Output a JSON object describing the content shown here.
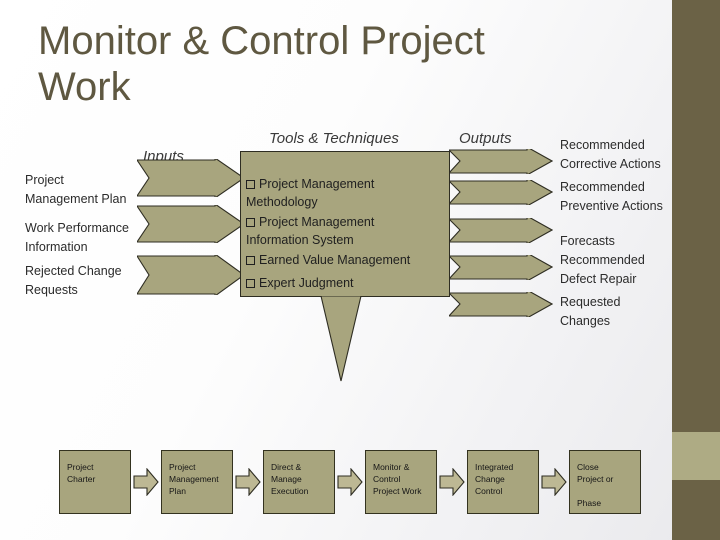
{
  "slide": {
    "title": "Monitor & Control Project\nWork",
    "accent_color": "#6b6246",
    "accent_light_color": "#aeab84",
    "shape_fill_color": "#a8a57e",
    "shape_outline_color": "#2e2d22"
  },
  "columns": {
    "inputs_heading": "Inputs",
    "tools_heading": "Tools & Techniques",
    "outputs_heading": "Outputs"
  },
  "inputs": [
    {
      "label": "Project\nManagement Plan"
    },
    {
      "label": "Work Performance\nInformation"
    },
    {
      "label": "Rejected Change\nRequests"
    }
  ],
  "tools": [
    {
      "bullet": "square-bullet-icon",
      "label": "Project Management\n  Methodology"
    },
    {
      "bullet": "square-bullet-icon",
      "label": "Project Management\n  Information System"
    },
    {
      "bullet": "square-bullet-icon",
      "label": "Earned Value Management"
    },
    {
      "bullet": "square-bullet-icon",
      "label": "Expert Judgment"
    }
  ],
  "outputs": [
    {
      "label": "Recommended\nCorrective Actions"
    },
    {
      "label": "Recommended\nPreventive Actions"
    },
    {
      "label": "Forecasts"
    },
    {
      "label": "Recommended\nDefect Repair"
    },
    {
      "label": "Requested\nChanges"
    }
  ],
  "process_chain": {
    "steps": [
      {
        "label": "Project\nCharter"
      },
      {
        "label": "Project\nManagement\nPlan"
      },
      {
        "label": "Direct &\nManage\nExecution"
      },
      {
        "label": "Monitor &\nControl\nProject Work"
      },
      {
        "label": "Integrated\nChange\nControl"
      },
      {
        "label": "Close\nProject or\n\nPhase"
      }
    ],
    "connector": "right-arrow-icon"
  }
}
